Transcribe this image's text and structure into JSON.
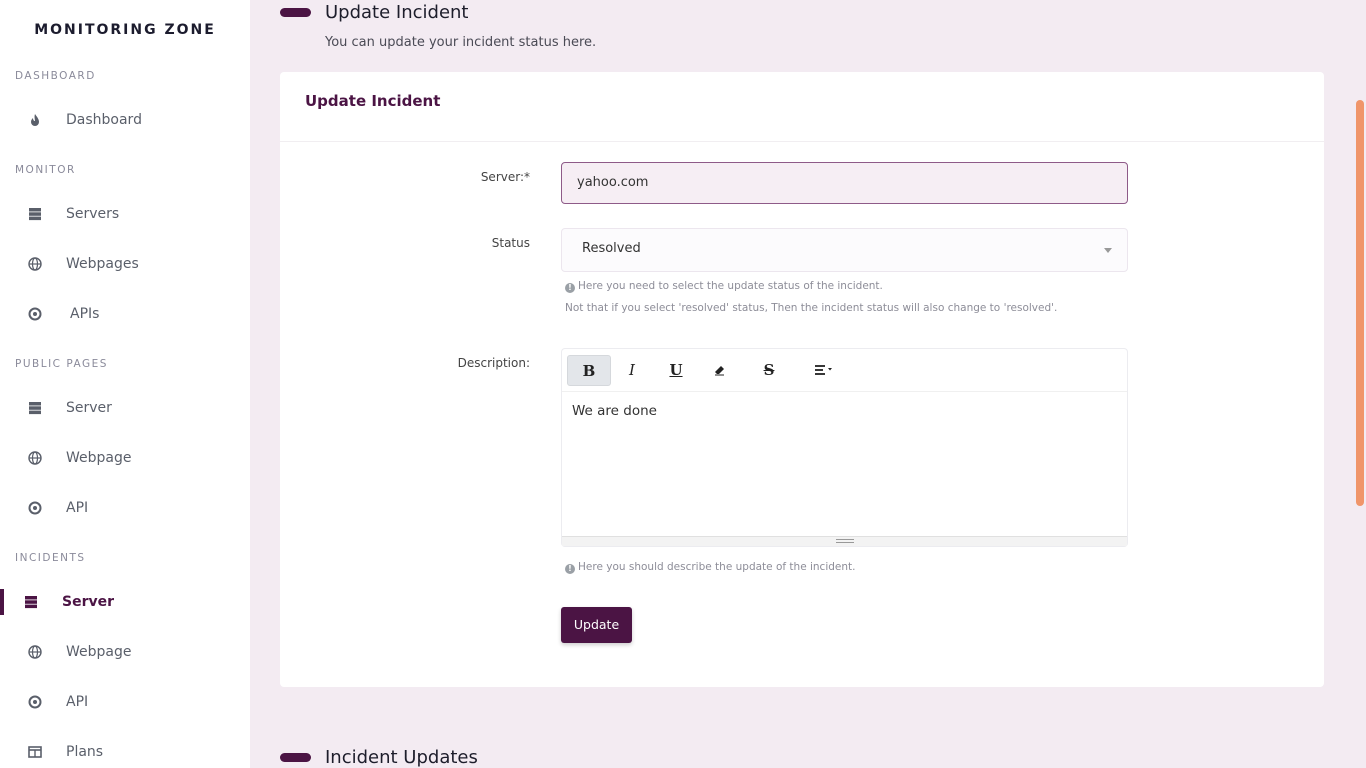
{
  "brand": "MONITORING ZONE",
  "sidebar": {
    "sections": [
      {
        "label": "DASHBOARD",
        "items": [
          {
            "label": "Dashboard",
            "icon": "fire-icon"
          }
        ]
      },
      {
        "label": "MONITOR",
        "items": [
          {
            "label": "Servers",
            "icon": "server-icon"
          },
          {
            "label": "Webpages",
            "icon": "globe-icon"
          },
          {
            "label": "APIs",
            "icon": "circle-dot-icon"
          }
        ]
      },
      {
        "label": "PUBLIC PAGES",
        "items": [
          {
            "label": "Server",
            "icon": "server-icon"
          },
          {
            "label": "Webpage",
            "icon": "globe-icon"
          },
          {
            "label": "API",
            "icon": "circle-dot-icon"
          }
        ]
      },
      {
        "label": "INCIDENTS",
        "items": [
          {
            "label": "Server",
            "icon": "server-icon",
            "active": true
          },
          {
            "label": "Webpage",
            "icon": "globe-icon"
          },
          {
            "label": "API",
            "icon": "circle-dot-icon"
          },
          {
            "label": "Plans",
            "icon": "table-icon"
          }
        ]
      }
    ]
  },
  "page": {
    "title": "Update Incident",
    "subtitle": "You can update your incident status here."
  },
  "card": {
    "title": "Update Incident",
    "server_label": "Server:*",
    "server_value": "yahoo.com",
    "status_label": "Status",
    "status_value": "Resolved",
    "status_hint_1": "Here you need to select the update status of the incident.",
    "status_hint_2": "Not that if you select 'resolved' status, Then the incident status will also change to 'resolved'.",
    "description_label": "Description:",
    "description_value": "We are done",
    "description_hint": "Here you should describe the update of the incident.",
    "toolbar": {
      "bold": "B",
      "italic": "I",
      "underline": "U",
      "strike": "S"
    },
    "update_button": "Update"
  },
  "section2": {
    "title": "Incident Updates"
  },
  "colors": {
    "primary": "#4b1444",
    "background": "#f3ebf2",
    "scrollbar": "#f0956a"
  }
}
